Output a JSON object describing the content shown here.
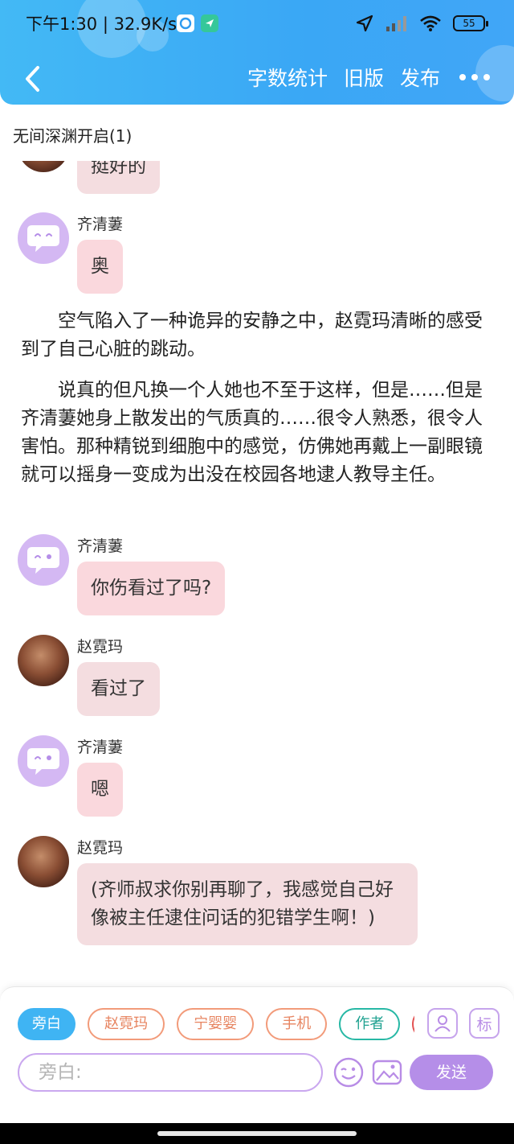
{
  "status_bar": {
    "time_speed": "下午1:30 | 32.9K/s",
    "battery": "55"
  },
  "nav": {
    "actions": [
      "字数统计",
      "旧版",
      "发布"
    ]
  },
  "chapter": {
    "title": "无间深渊开启(1)"
  },
  "messages": {
    "m0": {
      "text": "挺好的"
    },
    "m1": {
      "sender": "齐清萋",
      "text": "奥"
    },
    "n1": "空气陷入了一种诡异的安静之中，赵霓玛清晰的感受到了自己心脏的跳动。",
    "n2": "说真的但凡换一个人她也不至于这样，但是……但是齐清萋她身上散发出的气质真的……很令人熟悉，很令人害怕。那种精锐到细胞中的感觉，仿佛她再戴上一副眼镜就可以摇身一变成为出没在校园各地逮人教导主任。",
    "m2": {
      "sender": "齐清萋",
      "text": "你伤看过了吗?"
    },
    "m3": {
      "sender": "赵霓玛",
      "text": "看过了"
    },
    "m4": {
      "sender": "齐清萋",
      "text": "嗯"
    },
    "m5": {
      "sender": "赵霓玛",
      "text": "(齐师叔求你别再聊了，我感觉自己好像被主任逮住问话的犯错学生啊！)"
    }
  },
  "composer": {
    "roles": [
      "旁白",
      "赵霓玛",
      "宁婴婴",
      "手机",
      "作者"
    ],
    "tool_label": "标",
    "input_placeholder": "旁白:",
    "send_label": "发送"
  },
  "colors": {
    "header": "#3aa7f5",
    "bubble": "#fad8dd",
    "accent_purple": "#b58ee8",
    "active_chip": "#3fb4f3"
  }
}
